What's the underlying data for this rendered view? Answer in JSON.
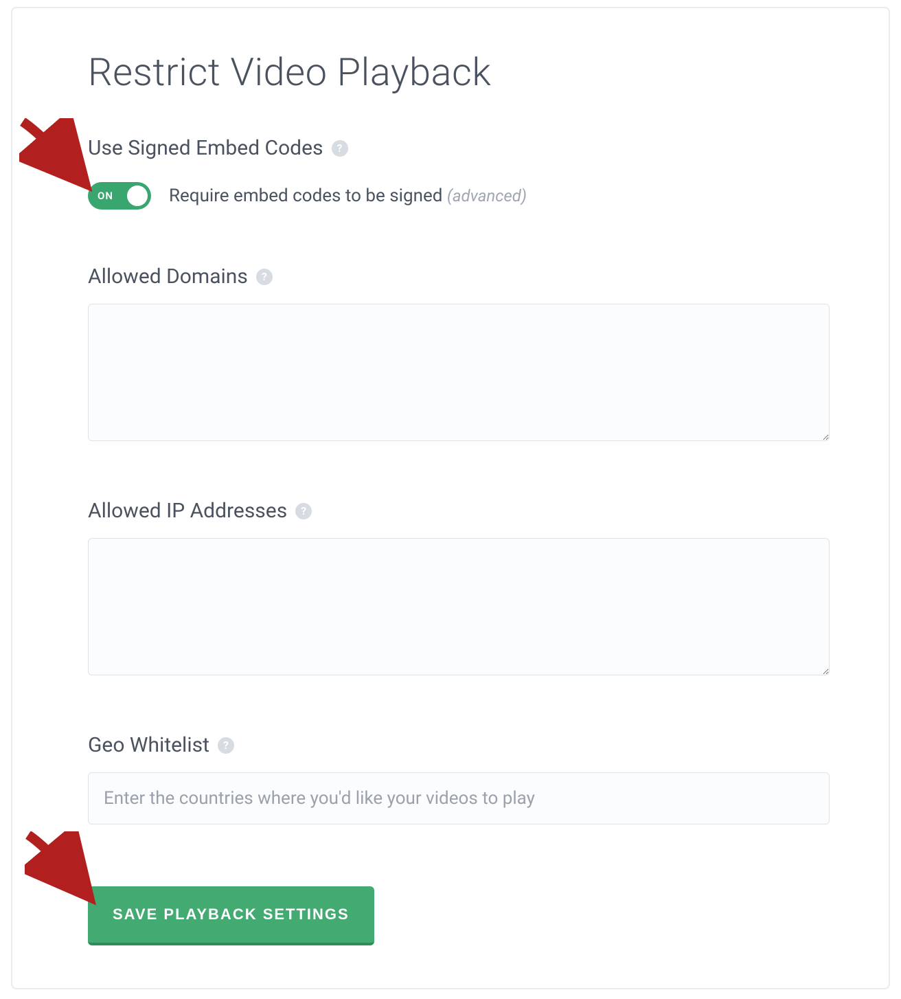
{
  "title": "Restrict Video Playback",
  "signed": {
    "label": "Use Signed Embed Codes",
    "toggle_state": "ON",
    "description": "Require embed codes to be signed",
    "advanced_hint": "(advanced)"
  },
  "allowed_domains": {
    "label": "Allowed Domains",
    "value": ""
  },
  "allowed_ips": {
    "label": "Allowed IP Addresses",
    "value": ""
  },
  "geo_whitelist": {
    "label": "Geo Whitelist",
    "placeholder": "Enter the countries where you'd like your videos to play",
    "value": ""
  },
  "save_label": "SAVE PLAYBACK SETTINGS",
  "help_glyph": "?"
}
